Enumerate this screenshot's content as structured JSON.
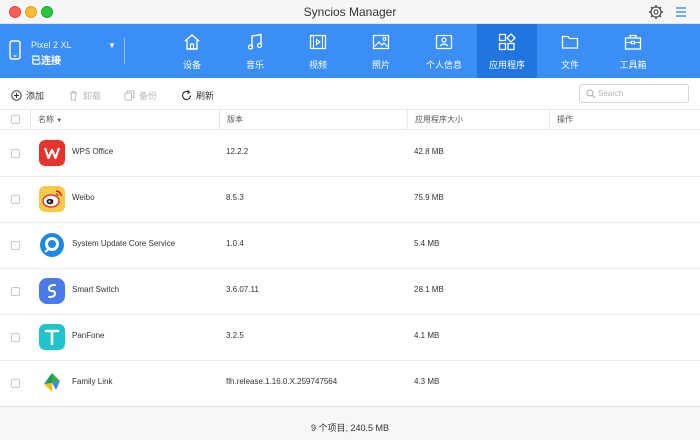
{
  "window": {
    "title": "Syncios Manager"
  },
  "device": {
    "name": "Pixel 2 XL",
    "status": "已连接"
  },
  "nav": [
    {
      "id": "device",
      "label": "设备",
      "icon": "home-icon"
    },
    {
      "id": "music",
      "label": "音乐",
      "icon": "music-icon"
    },
    {
      "id": "video",
      "label": "视频",
      "icon": "video-icon"
    },
    {
      "id": "photos",
      "label": "照片",
      "icon": "photo-icon"
    },
    {
      "id": "info",
      "label": "个人信息",
      "icon": "contact-icon"
    },
    {
      "id": "apps",
      "label": "应用程序",
      "icon": "apps-icon",
      "active": true
    },
    {
      "id": "files",
      "label": "文件",
      "icon": "folder-icon"
    },
    {
      "id": "toolbox",
      "label": "工具箱",
      "icon": "toolbox-icon"
    }
  ],
  "toolbar": {
    "add_label": "添加",
    "uninstall_label": "卸载",
    "backup_label": "备份",
    "refresh_label": "刷新",
    "search_placeholder": "Search"
  },
  "table": {
    "columns": {
      "name": "名称",
      "version": "版本",
      "size": "应用程序大小",
      "action": "操作"
    },
    "rows": [
      {
        "name": "WPS Office",
        "version": "12.2.2",
        "size": "42.8 MB",
        "icon": "wps-office-icon"
      },
      {
        "name": "Weibo",
        "version": "8.5.3",
        "size": "75.9 MB",
        "icon": "weibo-icon"
      },
      {
        "name": "System Update Core Service",
        "version": "1.0.4",
        "size": "5.4 MB",
        "icon": "system-update-icon"
      },
      {
        "name": "Smart Switch",
        "version": "3.6.07.11",
        "size": "28.1 MB",
        "icon": "smart-switch-icon"
      },
      {
        "name": "PanFone",
        "version": "3.2.5",
        "size": "4.1 MB",
        "icon": "panfone-icon"
      },
      {
        "name": "Family Link",
        "version": "flh.release.1.16.0.X.259747564",
        "size": "4.3 MB",
        "icon": "family-link-icon"
      }
    ]
  },
  "footer": {
    "summary": "9 个项目, 240.5 MB"
  },
  "colors": {
    "accent": "#3a8ef6",
    "accent_active": "#1f76e0"
  }
}
